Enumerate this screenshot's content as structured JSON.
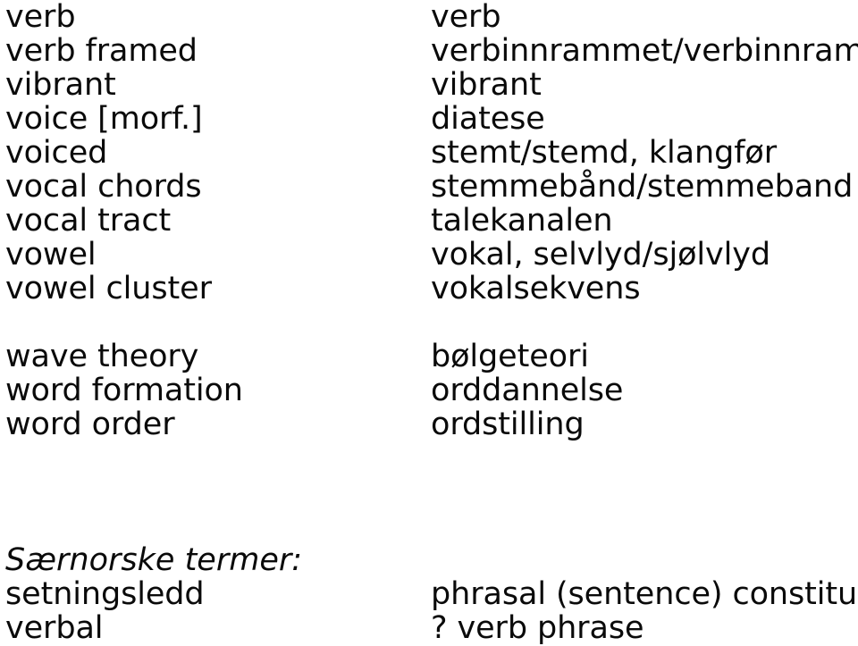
{
  "page": {
    "background_color": "#ffffff",
    "text_color": "#0a0a0a",
    "language_pair": "english-norwegian"
  },
  "glossary": {
    "entries": [
      {
        "en": "verb",
        "no": "verb"
      },
      {
        "en": "verb framed",
        "no": "verbinnrammet/verbinnramma"
      },
      {
        "en": "vibrant",
        "no": "vibrant"
      },
      {
        "en": "voice [morf.]",
        "no": "diatese"
      },
      {
        "en": "voiced",
        "no": "stemt/stemd, klangfør"
      },
      {
        "en": "vocal chords",
        "no": "stemmebånd/stemmeband"
      },
      {
        "en": "vocal tract",
        "no": "talekanalen"
      },
      {
        "en": "vowel",
        "no": "vokal, selvlyd/sjølvlyd"
      },
      {
        "en": "vowel cluster",
        "no": "vokalsekvens"
      },
      {
        "en": "",
        "no": ""
      },
      {
        "en": "wave theory",
        "no": "bølgeteori"
      },
      {
        "en": "word formation",
        "no": "orddannelse"
      },
      {
        "en": "word order",
        "no": "ordstilling"
      }
    ]
  },
  "section": {
    "heading": "Særnorske termer:",
    "entries": [
      {
        "no": "setningsledd",
        "en": "phrasal (sentence) constituent"
      },
      {
        "no": "verbal",
        "en": "? verb phrase"
      }
    ]
  }
}
